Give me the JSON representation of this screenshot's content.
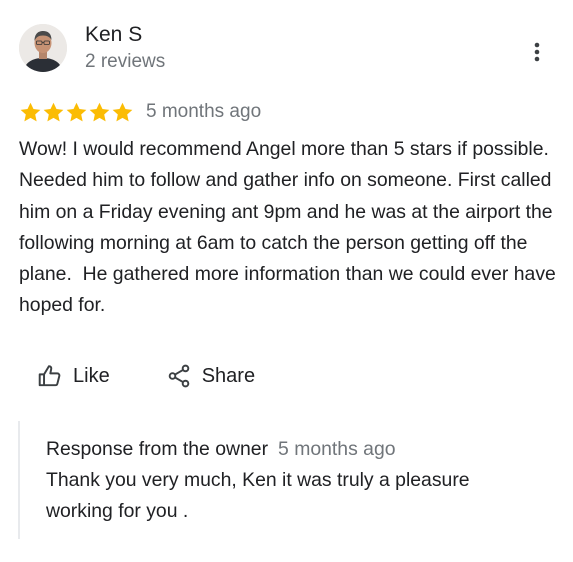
{
  "author": {
    "name": "Ken S",
    "meta": "2 reviews"
  },
  "rating": {
    "value": 5,
    "max": 5,
    "star_color": "#fbbc04",
    "date": "5 months ago"
  },
  "review": {
    "text": "Wow! I would recommend Angel more than 5 stars if possible.  Needed him to follow and gather info on someone. First called him on a Friday evening ant 9pm and he was at the airport the following morning at 6am to catch the person getting off the plane.  He gathered more information than we could ever have hoped for."
  },
  "actions": {
    "like_label": "Like",
    "share_label": "Share"
  },
  "owner_response": {
    "title": "Response from the owner",
    "date": "5 months ago",
    "text": "Thank you very much, Ken it was truly a pleasure working for you ."
  },
  "icons": {
    "more": "more-vert-icon",
    "like": "thumb-up-icon",
    "share": "share-icon",
    "star": "star-icon"
  }
}
